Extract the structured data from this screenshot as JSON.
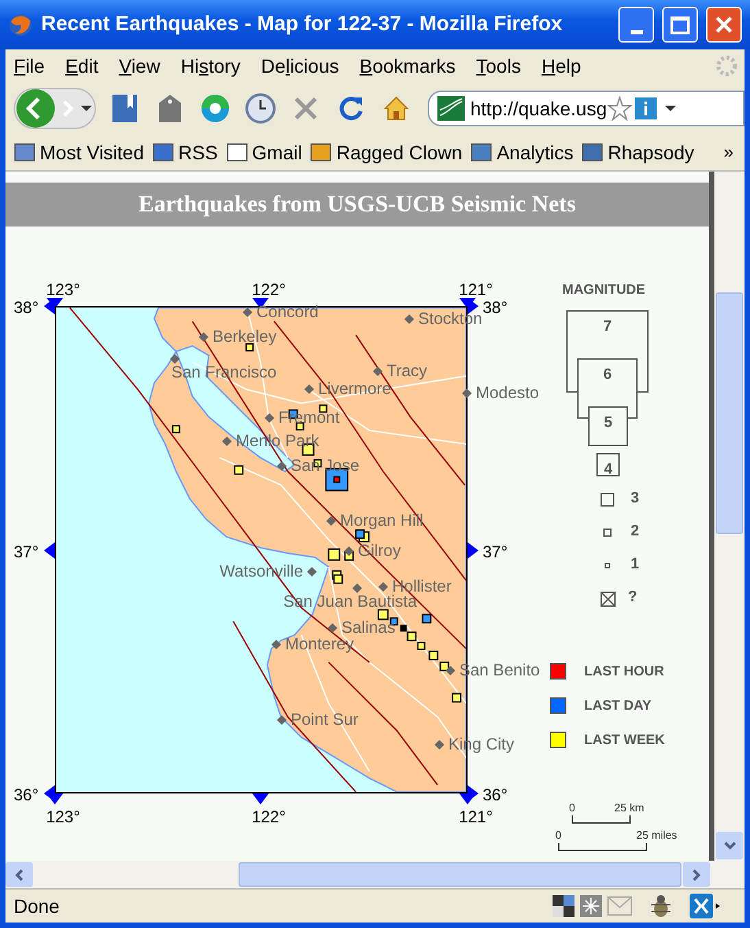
{
  "window": {
    "title": "Recent Earthquakes - Map for 122-37 - Mozilla Firefox"
  },
  "menu": [
    {
      "key": "F",
      "after": "ile"
    },
    {
      "key": "E",
      "after": "dit"
    },
    {
      "key": "V",
      "after": "iew"
    },
    {
      "before": "Hi",
      "key": "s",
      "after": "tory"
    },
    {
      "before": "De",
      "key": "l",
      "after": "icious"
    },
    {
      "key": "B",
      "after": "ookmarks"
    },
    {
      "key": "T",
      "after": "ools"
    },
    {
      "key": "H",
      "after": "elp"
    }
  ],
  "address": {
    "value": "http://quake.usg"
  },
  "bookmarks": {
    "items": [
      "Most Visited",
      "RSS",
      "Gmail",
      "Ragged Clown",
      "Analytics",
      "Rhapsody"
    ],
    "overflow": "»"
  },
  "page": {
    "heading": "Earthquakes from USGS-UCB Seismic Nets",
    "map": {
      "top_ticks": [
        "123°",
        "122°",
        "121°"
      ],
      "bottom_ticks": [
        "123°",
        "122°",
        "121°"
      ],
      "left_ticks": [
        "38°",
        "37°",
        "36°"
      ],
      "right_ticks": [
        "38°",
        "37°",
        "36°"
      ],
      "cities": [
        "Concord",
        "Berkeley",
        "San Francisco",
        "Stockton",
        "Tracy",
        "Livermore",
        "Modesto",
        "Fremont",
        "Menlo Park",
        "San Jose",
        "Morgan Hill",
        "Gilroy",
        "Watsonville",
        "San Juan Bautista",
        "Hollister",
        "Salinas",
        "Monterey",
        "San Benito",
        "Point Sur",
        "King City"
      ]
    },
    "legend": {
      "title": "MAGNITUDE",
      "large": [
        "7",
        "6",
        "5",
        "4"
      ],
      "small": [
        "3",
        "2",
        "1",
        "?"
      ],
      "ages": [
        {
          "label": "LAST HOUR",
          "color": "#ff0000"
        },
        {
          "label": "LAST DAY",
          "color": "#0066ff"
        },
        {
          "label": "LAST WEEK",
          "color": "#ffff00"
        }
      ],
      "scale_km": [
        "0",
        "25 km"
      ],
      "scale_miles": [
        "0",
        "25 miles"
      ]
    }
  },
  "status_bar": {
    "text": "Done"
  }
}
